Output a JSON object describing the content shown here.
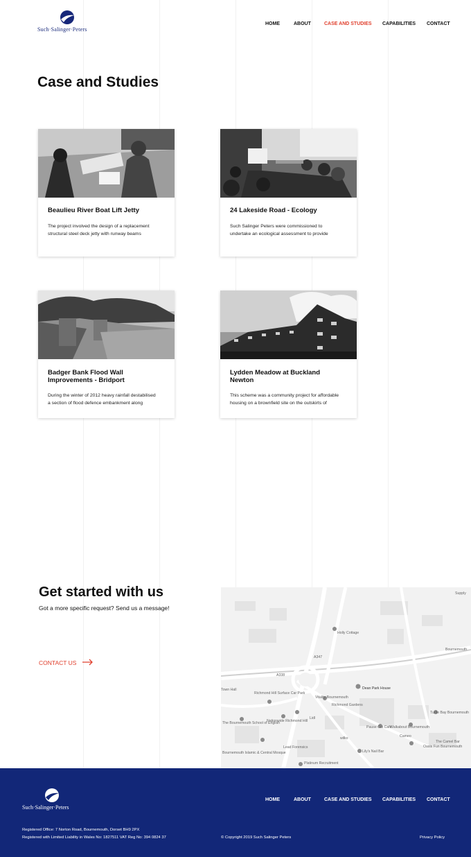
{
  "header": {
    "logo_text": "Such·Salinger·Peters",
    "nav": [
      {
        "label": "HOME",
        "active": false
      },
      {
        "label": "ABOUT",
        "active": false
      },
      {
        "label": "CASE AND STUDIES",
        "active": true
      },
      {
        "label": "CAPABILITIES",
        "active": false
      },
      {
        "label": "CONTACT",
        "active": false
      }
    ]
  },
  "page": {
    "title": "Case and Studies"
  },
  "cards": [
    {
      "title": "Beaulieu River Boat Lift Jetty",
      "desc_line1": "The project involved the design of a replacement",
      "desc_line2": "structural steel deck jetty with runway beams"
    },
    {
      "title": "24 Lakeside Road - Ecology",
      "desc_line1": "Such Salinger Peters were commissioned to",
      "desc_line2": "undertake an ecological assessment to provide"
    },
    {
      "title_line1": "Badger Bank Flood Wall",
      "title_line2": "Improvements - Bridport",
      "desc_line1": "During the winter of 2012 heavy rainfall destabilised",
      "desc_line2": "a section of flood defence embankment along"
    },
    {
      "title_line1": "Lydden Meadow at Buckland",
      "title_line2": "Newton",
      "desc_line1": "This scheme was a community project for affordable",
      "desc_line2": "housing on a brownfield site on the outskirts of"
    }
  ],
  "cta": {
    "title": "Get started with us",
    "subtitle": "Got a more specific request? Send us a message!",
    "link_label": "CONTACT US"
  },
  "map": {
    "labels": [
      "Holly Cottage",
      "Dean Park House",
      "Vitality Bournemouth",
      "Richmond Hill Surface Car Park",
      "Nationwide Richmond Hill",
      "The Bournemouth School of English",
      "Pause Cat Cafe",
      "Walkabout Bournemouth",
      "Turtle Bay Bournemouth",
      "The Camel Bar",
      "Oasis Fun Bournemouth",
      "Lead Forensics",
      "Lily's Nail Bar",
      "Platinum Recruitment",
      "Bournemouth Islamic & Central Mosque",
      "Lidl",
      "wilko",
      "Richmond Gardens",
      "Cameo",
      "A338",
      "A347",
      "Town Hall",
      "Bournemouth",
      "Supply"
    ]
  },
  "footer": {
    "logo_text": "Such·Salinger·Peters",
    "nav": [
      "HOME",
      "ABOUT",
      "CASE AND STUDIES",
      "CAPABILITIES",
      "CONTACT"
    ],
    "registered_office": "Registered Office: 7 Norton Road, Bournemouth, Dorset BH9 2PX",
    "registered_company": "Registered with Limited Liability in Wales No: 1827511 VAT Reg No: 394 0824 37",
    "copyright": "© Copyright 2019 Such Salinger Peters",
    "privacy": "Privacy Policy"
  },
  "colors": {
    "accent": "#e0402e",
    "brand_navy": "#122778",
    "logo_navy": "#17287a"
  }
}
